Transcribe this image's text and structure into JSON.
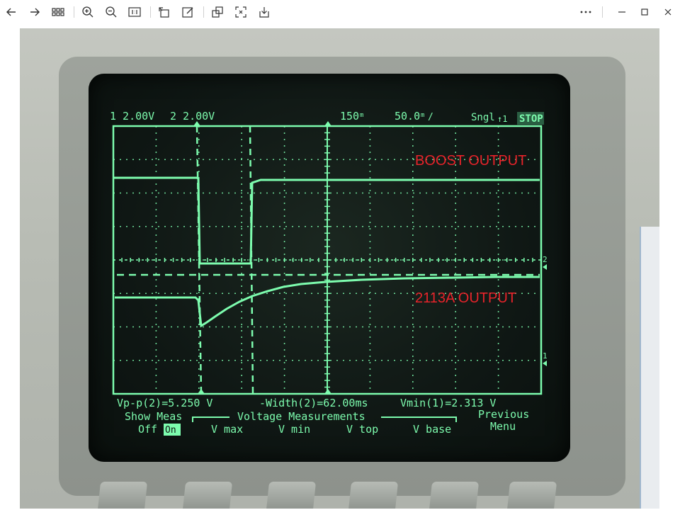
{
  "toolbar": {
    "buttons": [
      {
        "name": "back-icon"
      },
      {
        "name": "forward-icon"
      },
      {
        "name": "grid-view-icon"
      },
      {
        "name": "zoom-in-icon"
      },
      {
        "name": "zoom-out-icon"
      },
      {
        "name": "actual-size-icon"
      },
      {
        "name": "rotate-icon"
      },
      {
        "name": "edit-icon"
      },
      {
        "name": "crop-icon"
      },
      {
        "name": "fit-screen-icon"
      },
      {
        "name": "save-icon"
      },
      {
        "name": "more-icon"
      },
      {
        "name": "minimize-icon"
      },
      {
        "name": "maximize-icon"
      },
      {
        "name": "close-icon"
      }
    ]
  },
  "scope": {
    "ch1_scale": "1 2.00V",
    "ch2_scale": "2 2.00V",
    "delay": "150",
    "delay_unit": "m",
    "timebase": "50.0",
    "timebase_unit": "m",
    "timebase_suffix": "/",
    "trigger_mode": "Sngl",
    "trigger_source": "↑1",
    "run_state": "STOP",
    "ch2_marker": "2",
    "ch1_marker": "1",
    "meas_vpp": "Vp-p(2)=5.250 V",
    "meas_width": "-Width(2)=62.00ms",
    "meas_vmin": "Vmin(1)=2.313 V",
    "softkeys": {
      "show_meas": "Show Meas",
      "off": "Off",
      "on": "On",
      "group_title": "Voltage Measurements",
      "vmax": "V max",
      "vmin": "V min",
      "vtop": "V top",
      "vbase": "V base",
      "previous": "Previous",
      "menu": "Menu"
    }
  },
  "annotations": {
    "boost": "BOOST OUTPUT",
    "ldo": "2113A OUTPUT"
  },
  "colors": {
    "trace": "#7dfcae",
    "annotation": "#e8232a",
    "crt_bg": "#0f1714"
  }
}
